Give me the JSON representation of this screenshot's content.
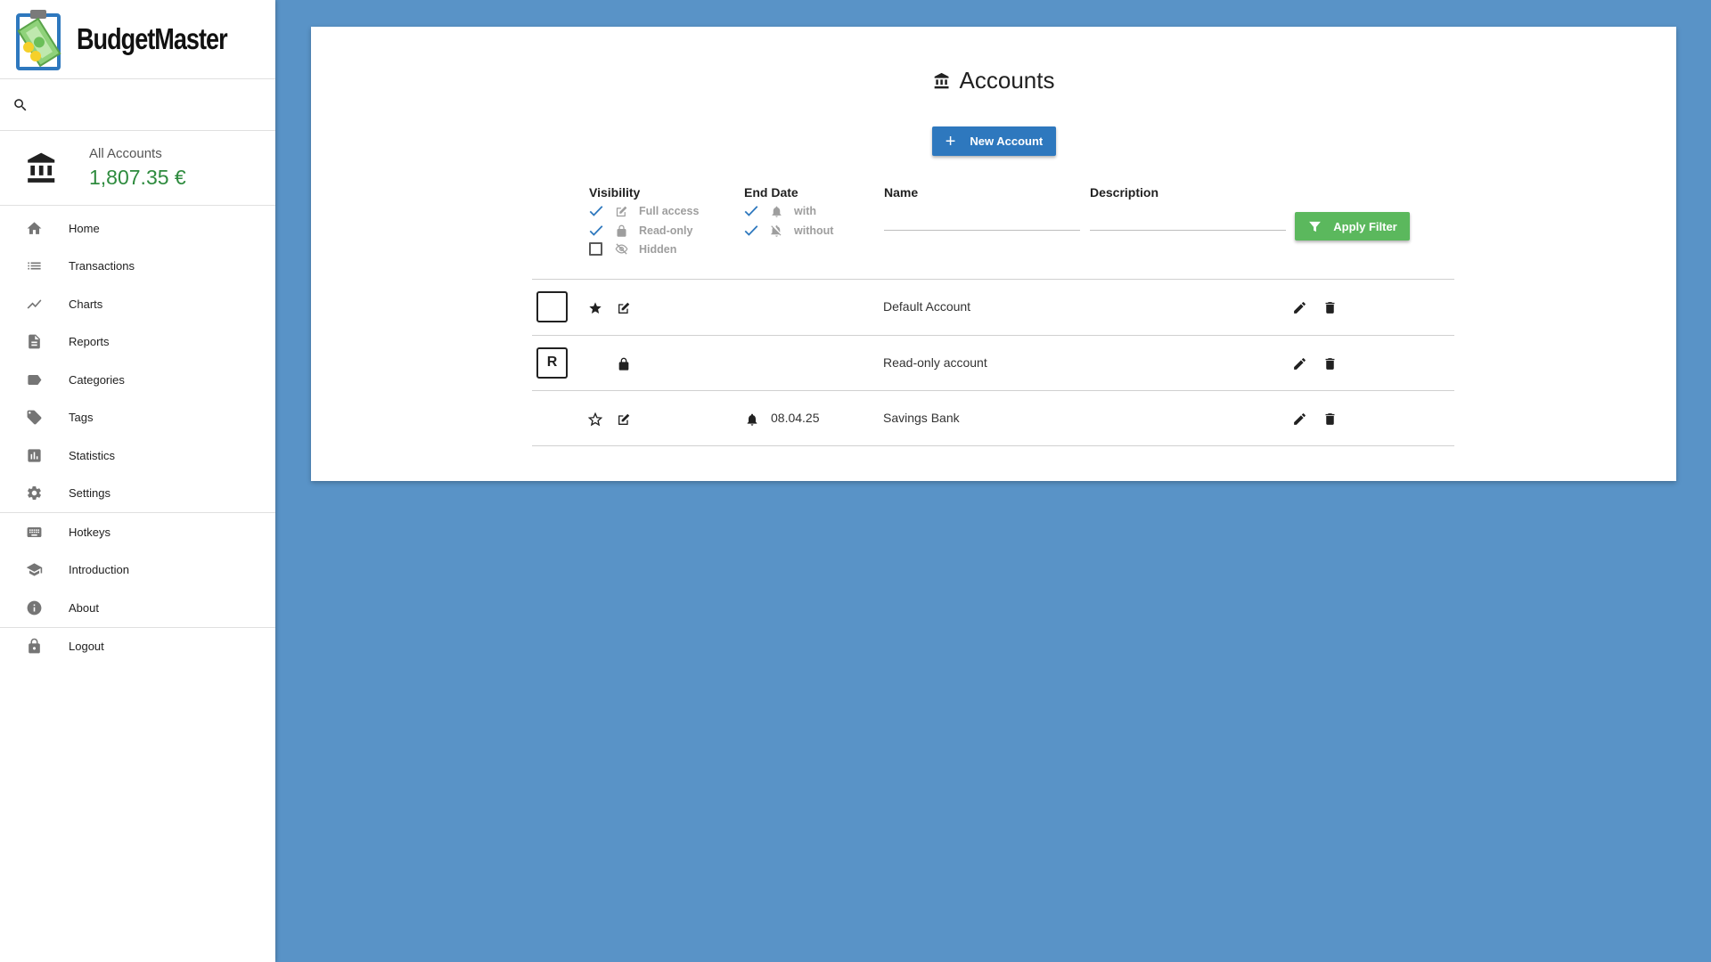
{
  "app": {
    "name": "BudgetMaster"
  },
  "sidebar": {
    "account_label": "All Accounts",
    "account_balance": "1,807.35 €",
    "nav": [
      {
        "label": "Home",
        "icon": "home-icon"
      },
      {
        "label": "Transactions",
        "icon": "list-icon"
      },
      {
        "label": "Charts",
        "icon": "line-chart-icon"
      },
      {
        "label": "Reports",
        "icon": "report-icon"
      },
      {
        "label": "Categories",
        "icon": "label-icon"
      },
      {
        "label": "Tags",
        "icon": "tag-icon"
      },
      {
        "label": "Statistics",
        "icon": "bar-chart-icon"
      },
      {
        "label": "Settings",
        "icon": "gear-icon"
      },
      {
        "label": "Hotkeys",
        "icon": "keyboard-icon"
      },
      {
        "label": "Introduction",
        "icon": "graduation-cap-icon"
      },
      {
        "label": "About",
        "icon": "info-icon"
      },
      {
        "label": "Logout",
        "icon": "lock-icon"
      }
    ]
  },
  "page": {
    "title": "Accounts",
    "new_account_label": "New Account",
    "apply_filter_label": "Apply Filter"
  },
  "filters": {
    "visibility_title": "Visibility",
    "visibility_options": [
      {
        "label": "Full access",
        "checked": true,
        "icon": "edit-icon"
      },
      {
        "label": "Read-only",
        "checked": true,
        "icon": "lock-icon"
      },
      {
        "label": "Hidden",
        "checked": false,
        "icon": "eye-off-icon"
      }
    ],
    "end_date_title": "End Date",
    "end_date_options": [
      {
        "label": "with",
        "checked": true,
        "icon": "bell-icon"
      },
      {
        "label": "without",
        "checked": true,
        "icon": "bell-off-icon"
      }
    ],
    "name_title": "Name",
    "name_value": "",
    "description_title": "Description",
    "description_value": ""
  },
  "accounts": [
    {
      "icon_text": "",
      "favorite": "filled",
      "access": "edit",
      "end_date": "",
      "name": "Default Account"
    },
    {
      "icon_text": "R",
      "favorite": "none",
      "access": "lock",
      "end_date": "",
      "name": "Read-only account"
    },
    {
      "icon_text": "",
      "favorite": "outline",
      "access": "edit",
      "end_date": "08.04.25",
      "name": "Savings Bank"
    }
  ],
  "colors": {
    "background": "#5993c7",
    "primary_button": "#2e78be",
    "apply_button": "#5bb85d",
    "balance": "#2e8b3e",
    "checkmark": "#2e78be"
  }
}
